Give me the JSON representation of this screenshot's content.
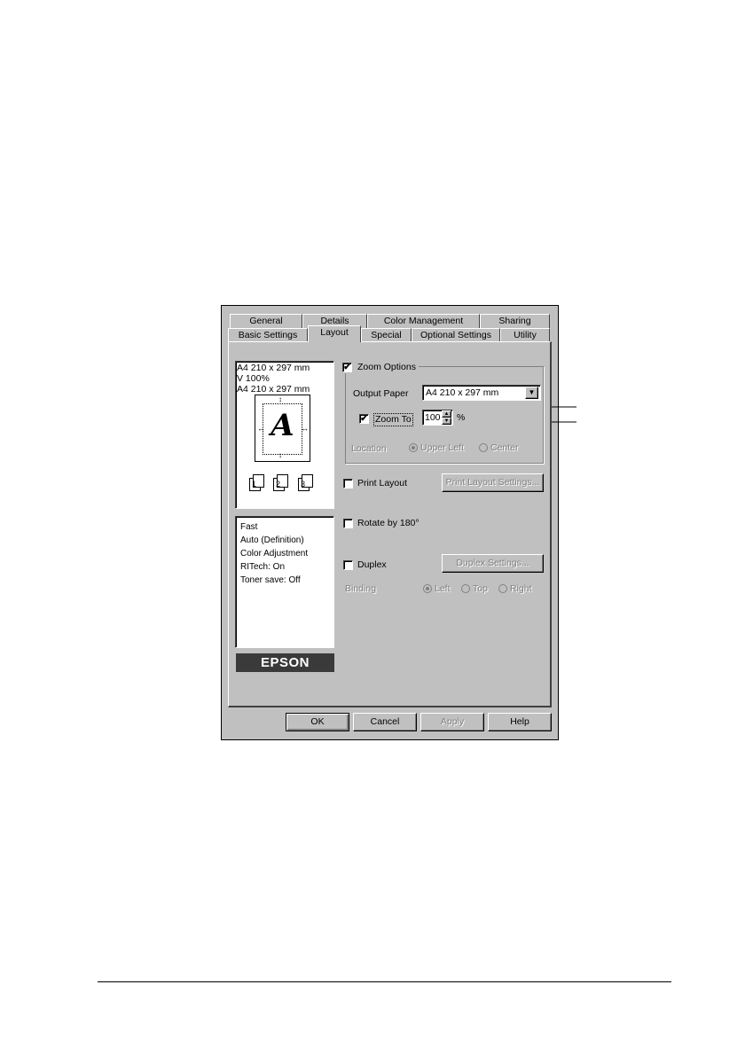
{
  "tabs_row1": [
    "General",
    "Details",
    "Color Management",
    "Sharing"
  ],
  "tabs_row2": [
    "Basic Settings",
    "Layout",
    "Special",
    "Optional Settings",
    "Utility"
  ],
  "preview": {
    "line1": "A4 210 x 297 mm",
    "line2": "V 100%",
    "line3": "A4 210 x 297 mm",
    "page_letter": "A",
    "page_numbers": [
      "1",
      "2",
      "3"
    ]
  },
  "summary": [
    "Fast",
    "Auto (Definition)",
    "Color Adjustment",
    "RITech: On",
    "Toner save: Off"
  ],
  "logo": "EPSON",
  "zoom": {
    "group_label": "Zoom Options",
    "output_paper_label": "Output Paper",
    "output_paper_value": "A4 210 x 297 mm",
    "zoom_to_label": "Zoom To",
    "zoom_value": "100",
    "percent": "%",
    "location_label": "Location",
    "upper_left": "Upper Left",
    "center": "Center"
  },
  "print_layout": {
    "label": "Print Layout",
    "button": "Print Layout Settings..."
  },
  "rotate": {
    "label": "Rotate by 180°"
  },
  "duplex": {
    "label": "Duplex",
    "button": "Duplex Settings...",
    "binding_label": "Binding",
    "left": "Left",
    "top": "Top",
    "right": "Right"
  },
  "buttons": {
    "ok": "OK",
    "cancel": "Cancel",
    "apply": "Apply",
    "help": "Help"
  },
  "checkbox_mark": "✔"
}
